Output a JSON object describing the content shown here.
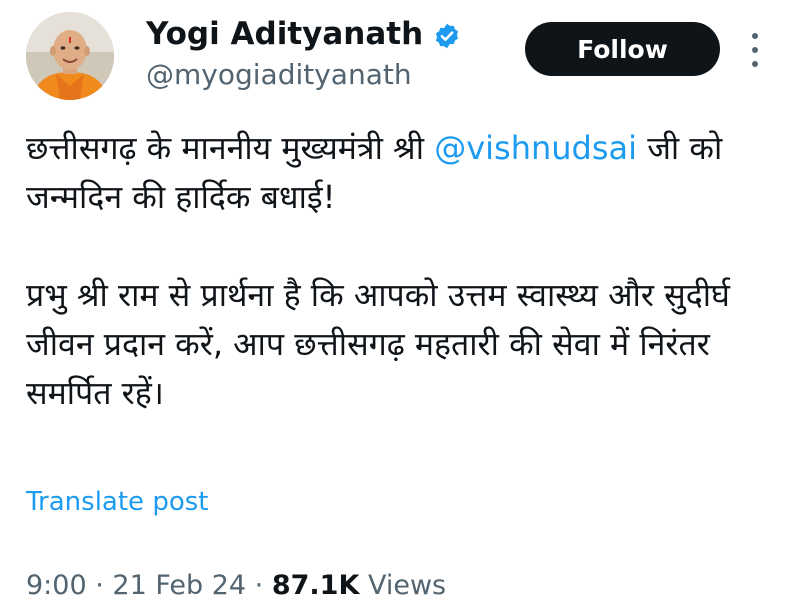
{
  "author": {
    "display_name": "Yogi Adityanath",
    "handle": "@myogiadityanath",
    "verified_icon": "verified-badge-icon",
    "avatar_icon": "profile-avatar"
  },
  "actions": {
    "follow_label": "Follow",
    "more_icon": "more-vertical-icon"
  },
  "post": {
    "line1_before_mention": "छत्तीसगढ़ के माननीय मुख्यमंत्री श्री ",
    "mention": "@vishnudsai",
    "line1_after_mention": " जी को जन्मदिन की हार्दिक बधाई!",
    "paragraph2": "प्रभु श्री राम से प्रार्थना है कि आपको उत्तम स्वास्थ्य और सुदीर्घ जीवन प्रदान करें, आप छत्तीसगढ़ महतारी की सेवा में निरंतर समर्पित रहें।"
  },
  "translate_label": "Translate post",
  "meta": {
    "time": "9:00",
    "separator": " · ",
    "date": "21 Feb 24",
    "views_count": "87.1K",
    "views_label": " Views"
  },
  "colors": {
    "accent": "#1d9bf0",
    "text": "#0f1419",
    "secondary": "#536471",
    "button_bg": "#0f1419"
  }
}
